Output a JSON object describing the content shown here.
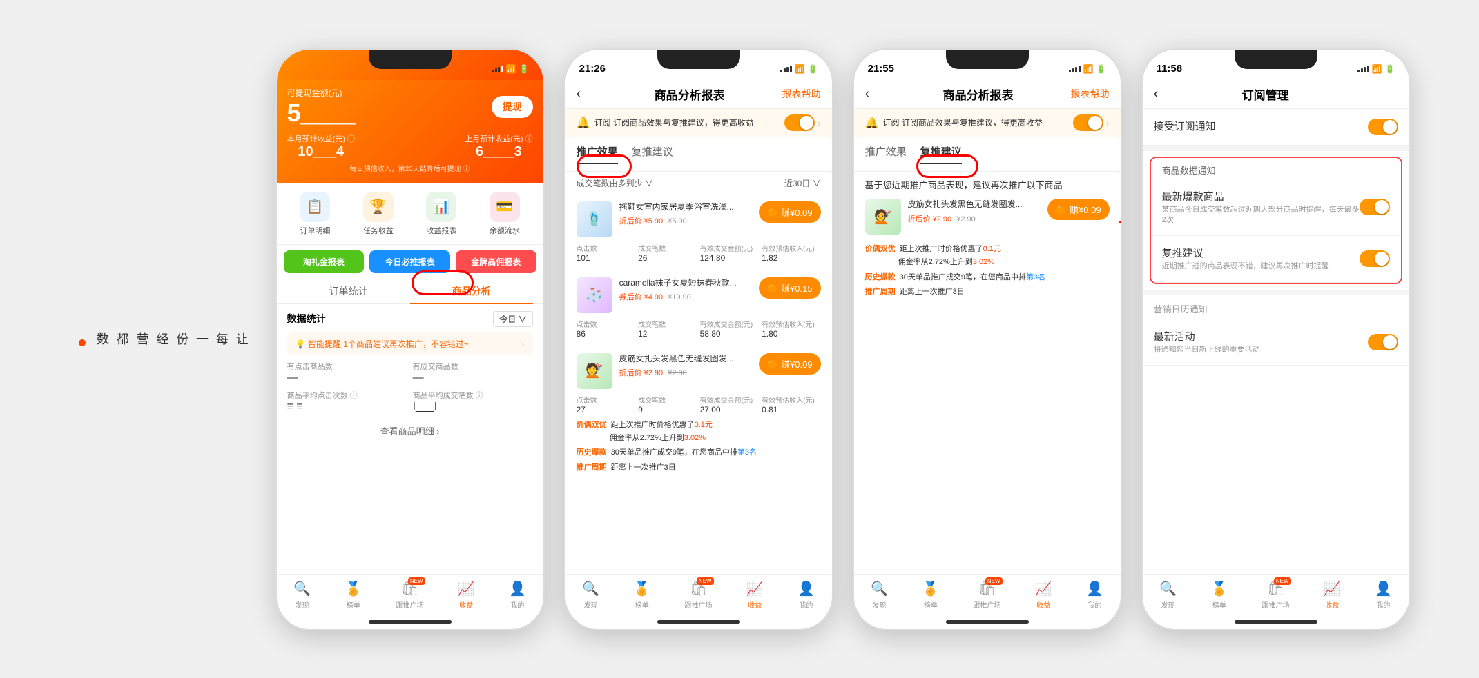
{
  "page": {
    "bg_color": "#f0f0f0"
  },
  "side_text": {
    "lines": [
      "让",
      "每",
      "一",
      "份",
      "经",
      "营",
      "都",
      "数"
    ],
    "dot": true
  },
  "phone1": {
    "status_bar": {
      "time": "",
      "show_icons": false
    },
    "header": {
      "available_label": "可提现金额(元)",
      "available_amount": "5____",
      "withdraw_btn": "提现",
      "month_label": "本月预计收益(元) ⓘ",
      "month_value": "10___4",
      "prev_month_label": "上月预计收益(元) ⓘ",
      "prev_month_value": "6____3",
      "note": "每日预估收入，第20天结算后可提现 ⓘ"
    },
    "quick_icons": [
      {
        "label": "订单明细",
        "icon": "📋",
        "color": "#e8f4ff"
      },
      {
        "label": "任务收益",
        "icon": "🏆",
        "color": "#fff3e0"
      },
      {
        "label": "收益报表",
        "icon": "📊",
        "color": "#e8f5e9"
      },
      {
        "label": "余额流水",
        "icon": "💳",
        "color": "#fce4ec"
      }
    ],
    "action_btns": [
      {
        "label": "淘礼金报表",
        "color": "#52c41a"
      },
      {
        "label": "今日必推报表",
        "color": "#1890ff"
      },
      {
        "label": "金牌高佣报表",
        "color": "#ff4d4f"
      }
    ],
    "tabs": [
      {
        "label": "订单统计",
        "active": false
      },
      {
        "label": "商品分析",
        "active": true
      }
    ],
    "stats": {
      "title": "数据统计",
      "period": "今日",
      "smart_tip": "智能提醒 1个商品建议再次推广，不容错过~",
      "items": [
        {
          "label": "有点击商品数",
          "value": "—"
        },
        {
          "label": "有成交商品数",
          "value": "—"
        },
        {
          "label": "商品平均点击次数 ⓘ",
          "value": "≡_≡"
        },
        {
          "label": "商品平均成交笔数 ⓘ",
          "value": "I___I"
        }
      ],
      "detail_link": "查看商品明细 >"
    },
    "bottom_tabs": [
      {
        "label": "发现",
        "icon": "🔍",
        "active": false
      },
      {
        "label": "榜单",
        "icon": "🏅",
        "active": false
      },
      {
        "label": "跟推广场",
        "icon": "🛍",
        "active": false,
        "badge": "NEW"
      },
      {
        "label": "收益",
        "icon": "📈",
        "active": true
      },
      {
        "label": "我的",
        "icon": "👤",
        "active": false
      }
    ]
  },
  "phone2": {
    "status_bar": {
      "time": "21:26"
    },
    "nav": {
      "title": "商品分析报表",
      "help": "报表帮助"
    },
    "subscribe_bar": {
      "icon": "🔔",
      "text": "订阅 订阅商品效果与复推建议，得更高收益",
      "toggle": "on"
    },
    "tabs": [
      {
        "label": "推广效果",
        "active": true
      },
      {
        "label": "复推建议",
        "active": false
      }
    ],
    "sort": {
      "left": "成交笔数由多到少 ∨",
      "right": "近30日 ∨"
    },
    "products": [
      {
        "name": "拖鞋女室内家居夏季浴室洗澡...",
        "price": "折后价 ¥5.90",
        "original": "¥5.90",
        "earn": "赚¥0.09",
        "stats": [
          {
            "label": "点击数",
            "value": "101"
          },
          {
            "label": "成交笔数",
            "value": "26"
          },
          {
            "label": "有效成交金额(元)",
            "value": "124.80"
          },
          {
            "label": "有效预估收入(元)",
            "value": "1.82"
          }
        ]
      },
      {
        "name": "caramella袜子女夏短袜春秋款...",
        "price": "券后价 ¥4.90",
        "original": "¥19.90",
        "earn": "赚¥0.15",
        "stats": [
          {
            "label": "点击数",
            "value": "86"
          },
          {
            "label": "成交笔数",
            "value": "12"
          },
          {
            "label": "有效成交金额(元)",
            "value": "58.80"
          },
          {
            "label": "有效预估收入(元)",
            "value": "1.80"
          }
        ]
      },
      {
        "name": "皮筋女扎头发黑色无缝发圈发...",
        "price": "折后价 ¥2.90",
        "original": "¥2.90",
        "earn": "赚¥0.09",
        "stats": [
          {
            "label": "点击数",
            "value": "27"
          },
          {
            "label": "成交笔数",
            "value": "9"
          },
          {
            "label": "有效成交金额(元)",
            "value": "27.00"
          },
          {
            "label": "有效预估收入(元)",
            "value": "0.81"
          }
        ]
      }
    ],
    "tips": {
      "tip1_tag": "价偶双优",
      "tip1_text": "距上次推广时价格优惠了",
      "tip1_highlight": "0.1元",
      "tip1_text2": "佣金率从2.72%上升到",
      "tip1_highlight2": "3.02%",
      "tip2_tag": "历史爆款",
      "tip2_text": "30天单品推广成交9笔，在您商品中排",
      "tip2_highlight": "第3名",
      "tip3_tag": "推广周期",
      "tip3_text": "距离上一次推广3日"
    }
  },
  "phone3": {
    "status_bar": {
      "time": "21:55"
    },
    "nav": {
      "title": "商品分析报表",
      "help": "报表帮助"
    },
    "subscribe_bar": {
      "icon": "🔔",
      "text": "订阅 订阅商品效果与复推建议，得更高收益",
      "toggle": "on"
    },
    "tabs": [
      {
        "label": "推广效果",
        "active": false
      },
      {
        "label": "复推建议",
        "active": true
      }
    ],
    "recommend_title": "基于您近期推广商品表现，建议再次推广以下商品",
    "product": {
      "name": "皮筋女扎头发黑色无缝发圈发...",
      "price": "折后价 ¥2.90",
      "original": "¥2.90",
      "earn": "赚¥0.09"
    },
    "tips": {
      "tip1_tag": "价偶双优",
      "tip1_text": "距上次推广时价格优惠了",
      "tip1_highlight": "0.1元",
      "tip1_text2": "佣金率从2.72%上升到",
      "tip1_highlight2": "3.02%",
      "tip2_tag": "历史爆款",
      "tip2_text": "30天单品推广成交9笔，在您商品中排",
      "tip2_highlight": "第3名",
      "tip3_tag": "推广周期",
      "tip3_text": "距离上一次推广3日"
    }
  },
  "phone4": {
    "status_bar": {
      "time": "11:58"
    },
    "nav": {
      "title": "订阅管理"
    },
    "sections": [
      {
        "items": [
          {
            "title": "接受订阅通知",
            "desc": "",
            "toggle": "on"
          }
        ]
      },
      {
        "header": "商品数据通知",
        "highlighted": true,
        "items": [
          {
            "title": "最新爆款商品",
            "desc": "某商品今日成交笔数超过近期大部分商品时提醒，每天最多2次",
            "toggle": "on"
          },
          {
            "title": "复推建议",
            "desc": "近期推广过的商品表现不错，建议再次推广时提醒",
            "toggle": "on"
          }
        ]
      },
      {
        "header": "营销日历通知",
        "items": [
          {
            "title": "最新活动",
            "desc": "将通知您当日新上线的重要活动",
            "toggle": "on"
          }
        ]
      }
    ],
    "bottom_tabs": [
      {
        "label": "发现",
        "icon": "🔍",
        "active": false
      },
      {
        "label": "榜单",
        "icon": "🏅",
        "active": false
      },
      {
        "label": "跟推广场",
        "icon": "🛍",
        "active": false,
        "badge": "NEW"
      },
      {
        "label": "收益",
        "icon": "📈",
        "active": true
      },
      {
        "label": "我的",
        "icon": "👤",
        "active": false
      }
    ]
  },
  "annotations": {
    "phone1_circle": "商品分析 tab circle",
    "phone2_circle": "推广效果 tab circle",
    "phone3_circle": "复推建议 tab circle",
    "arrow_text": "→"
  }
}
